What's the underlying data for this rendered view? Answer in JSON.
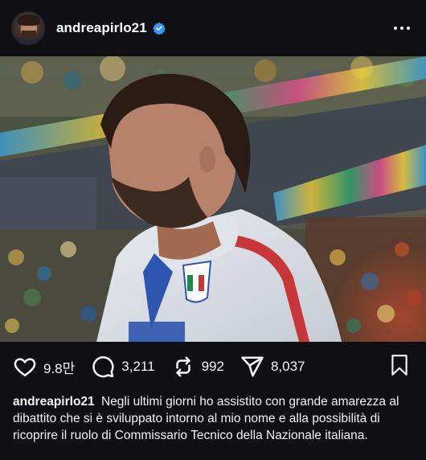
{
  "post": {
    "username": "andreapirlo21",
    "verified": true,
    "photo_alt": "Andrea Pirlo in Italia jacket at stadium"
  },
  "icons": {
    "verified": "verified-badge-icon",
    "more": "more-options-icon",
    "like": "heart-icon",
    "comment": "comment-bubble-icon",
    "repost": "repost-icon",
    "share": "send-icon",
    "save": "bookmark-icon"
  },
  "actions": {
    "likes": "9.8만",
    "comments": "3,211",
    "reposts": "992",
    "shares": "8,037"
  },
  "caption": {
    "username": "andreapirlo21",
    "text": "Negli ultimi giorni ho assistito con grande amarezza al dibattito che si è sviluppato intorno al mio nome e alla possibilità di ricoprire il ruolo di Commissario Tecnico della Nazionale italiana."
  },
  "colors": {
    "background": "#101014",
    "verified_blue": "#3797f0",
    "text": "#f5f5f5"
  }
}
